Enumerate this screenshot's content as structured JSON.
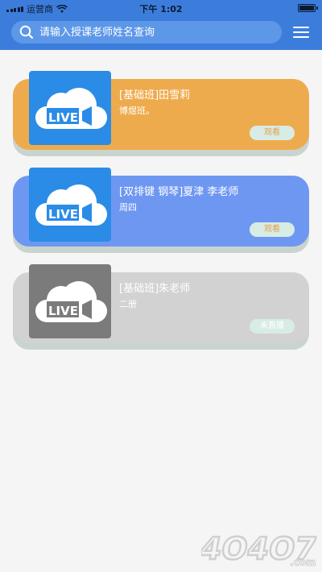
{
  "status_bar": {
    "carrier": "运营商",
    "time": "下午 1:02"
  },
  "search": {
    "placeholder": "请输入授课老师姓名查询"
  },
  "thumbnail_label": "LIVE",
  "courses": [
    {
      "title": "[基础班]田雪莉",
      "subtitle": "博煜班。",
      "button": "观看",
      "card_color": "#eeab4d",
      "thumb_color": "#2a8ce6",
      "button_text_color": "#e3a24a"
    },
    {
      "title": "[双排键 钢琴]夏津 李老师",
      "subtitle": "周四",
      "button": "观看",
      "card_color": "#6e97f1",
      "thumb_color": "#2a8ce6",
      "button_text_color": "#e3a24a"
    },
    {
      "title": "[基础班]朱老师",
      "subtitle": "二册",
      "button": "未直播",
      "card_color": "#d2d2d2",
      "thumb_color": "#7b7b7b",
      "button_text_color": "#ffffff"
    }
  ],
  "watermark": "4O4O7.com"
}
